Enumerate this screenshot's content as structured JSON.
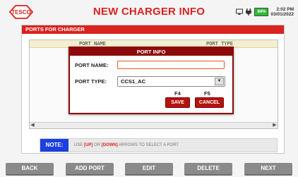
{
  "header": {
    "logo_text": "TESCO",
    "title": "NEW CHARGER INFO",
    "battery_label": "84%",
    "time": "2:02 PM",
    "date": "03/01/2022"
  },
  "panel": {
    "title": "PORTS FOR CHARGER",
    "columns": [
      "PORT NAME",
      "PORT TYPE"
    ]
  },
  "modal": {
    "title": "PORT INFO",
    "name_label": "PORT NAME:",
    "name_value": "",
    "type_label": "PORT TYPE:",
    "type_value": "CCS1_AC",
    "f4": "F4",
    "f5": "F5",
    "save_label": "SAVE",
    "cancel_label": "CANCEL"
  },
  "note": {
    "label": "NOTE:",
    "t1": "USE ",
    "up": "[UP]",
    "t2": " OR ",
    "down": "[DOWN]",
    "t3": " ARROWS TO SELECT A PORT"
  },
  "buttons": {
    "back": "BACK",
    "add_port": "ADD PORT",
    "edit": "EDIT",
    "delete": "DELETE",
    "next": "NEXT"
  },
  "colors": {
    "accent": "#d9231f",
    "modal": "#8c0a0a",
    "note": "#1c3fe0",
    "button": "#8a8a8a"
  }
}
